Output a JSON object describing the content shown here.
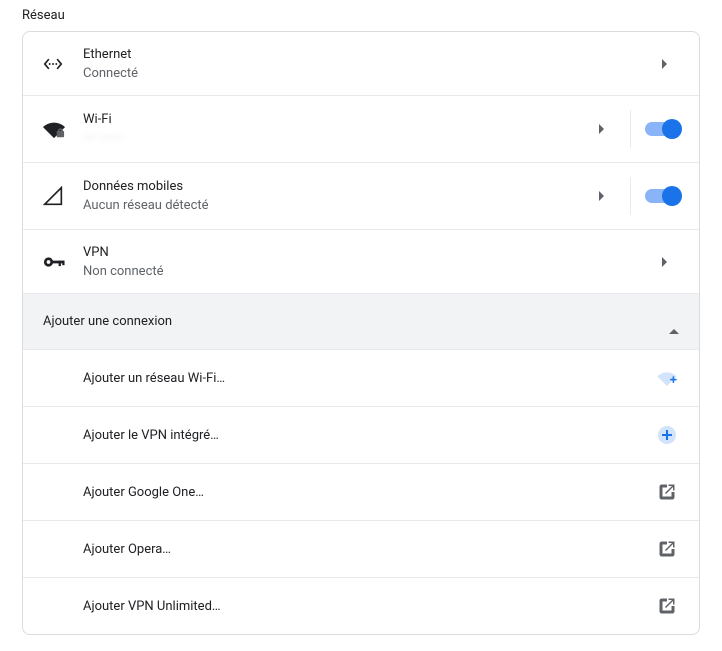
{
  "section_title": "Réseau",
  "rows": {
    "ethernet": {
      "title": "Ethernet",
      "subtitle": "Connecté"
    },
    "wifi": {
      "title": "Wi-Fi",
      "subtitle": "··· ·····"
    },
    "mobile": {
      "title": "Données mobiles",
      "subtitle": "Aucun réseau détecté"
    },
    "vpn": {
      "title": "VPN",
      "subtitle": "Non connecté"
    }
  },
  "add_connection_header": "Ajouter une connexion",
  "add_items": {
    "wifi": "Ajouter un réseau Wi-Fi…",
    "vpn": "Ajouter le VPN intégré…",
    "google_one": "Ajouter Google One…",
    "opera": "Ajouter Opera…",
    "vpn_unlimited": "Ajouter VPN Unlimited…"
  },
  "toggles": {
    "wifi_on": true,
    "mobile_on": true
  }
}
